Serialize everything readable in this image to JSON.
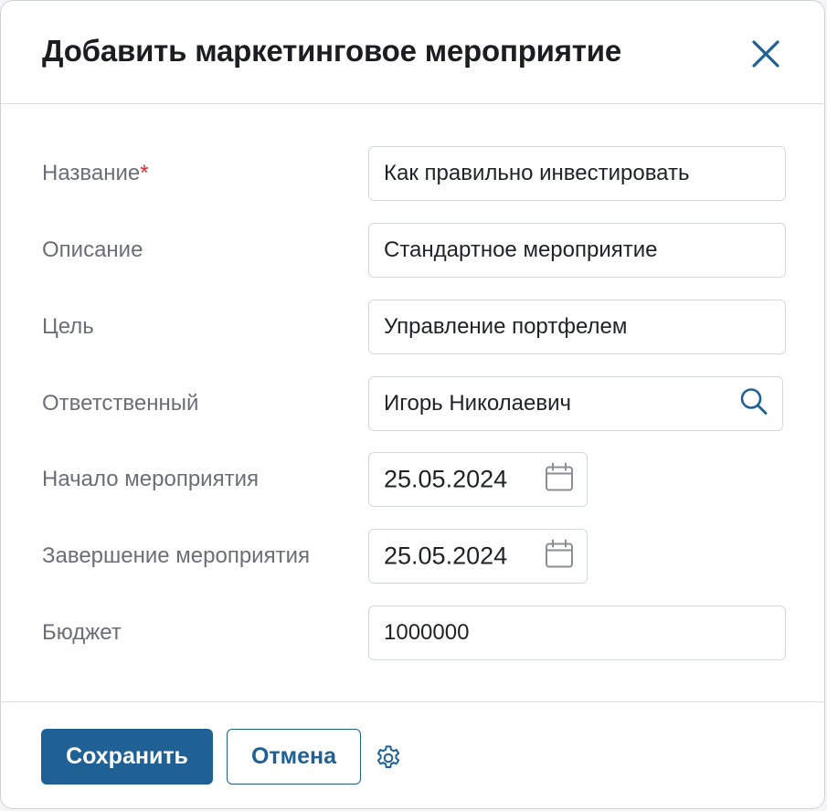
{
  "dialog": {
    "title": "Добавить маркетинговое мероприятие",
    "close_icon": "close-icon"
  },
  "fields": {
    "name": {
      "label": "Название",
      "required_mark": "*",
      "value": "Как правильно инвестировать"
    },
    "description": {
      "label": "Описание",
      "value": "Стандартное мероприятие"
    },
    "goal": {
      "label": "Цель",
      "value": "Управление портфелем"
    },
    "responsible": {
      "label": "Ответственный",
      "value": "Игорь Николаевич",
      "icon": "search-icon"
    },
    "start_date": {
      "label": "Начало мероприятия",
      "value": "25.05.2024",
      "icon": "calendar-icon"
    },
    "end_date": {
      "label": "Завершение мероприятия",
      "value": "25.05.2024",
      "icon": "calendar-icon"
    },
    "budget": {
      "label": "Бюджет",
      "value": "1000000"
    }
  },
  "footer": {
    "save_label": "Сохранить",
    "cancel_label": "Отмена",
    "settings_icon": "gear-icon"
  },
  "colors": {
    "primary": "#1f6194",
    "required": "#e0262f",
    "label": "#6a6f76",
    "border": "#d4d8dd"
  }
}
